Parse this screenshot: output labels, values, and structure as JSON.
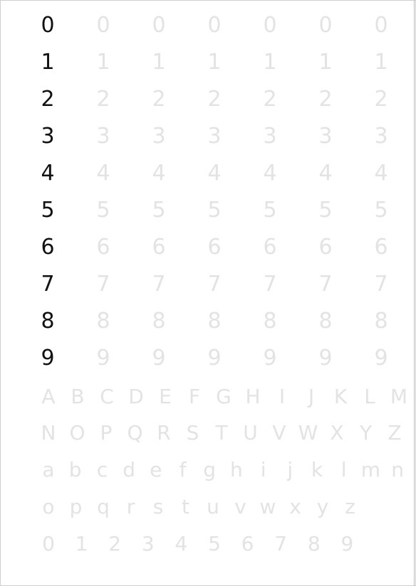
{
  "practice": {
    "digits": [
      {
        "model": "0",
        "traces": [
          "0",
          "0",
          "0",
          "0",
          "0",
          "0"
        ]
      },
      {
        "model": "1",
        "traces": [
          "1",
          "1",
          "1",
          "1",
          "1",
          "1"
        ]
      },
      {
        "model": "2",
        "traces": [
          "2",
          "2",
          "2",
          "2",
          "2",
          "2"
        ]
      },
      {
        "model": "3",
        "traces": [
          "3",
          "3",
          "3",
          "3",
          "3",
          "3"
        ]
      },
      {
        "model": "4",
        "traces": [
          "4",
          "4",
          "4",
          "4",
          "4",
          "4"
        ]
      },
      {
        "model": "5",
        "traces": [
          "5",
          "5",
          "5",
          "5",
          "5",
          "5"
        ]
      },
      {
        "model": "6",
        "traces": [
          "6",
          "6",
          "6",
          "6",
          "6",
          "6"
        ]
      },
      {
        "model": "7",
        "traces": [
          "7",
          "7",
          "7",
          "7",
          "7",
          "7"
        ]
      },
      {
        "model": "8",
        "traces": [
          "8",
          "8",
          "8",
          "8",
          "8",
          "8"
        ]
      },
      {
        "model": "9",
        "traces": [
          "9",
          "9",
          "9",
          "9",
          "9",
          "9"
        ]
      }
    ]
  },
  "alphabet": {
    "uppercase_1": [
      "A",
      "B",
      "C",
      "D",
      "E",
      "F",
      "G",
      "H",
      "I",
      "J",
      "K",
      "L",
      "M"
    ],
    "uppercase_2": [
      "N",
      "O",
      "P",
      "Q",
      "R",
      "S",
      "T",
      "U",
      "V",
      "W",
      "X",
      "Y",
      "Z"
    ],
    "lowercase_1": [
      "a",
      "b",
      "c",
      "d",
      "e",
      "f",
      "g",
      "h",
      "i",
      "j",
      "k",
      "l",
      "m",
      "n"
    ],
    "lowercase_2": [
      "o",
      "p",
      "q",
      "r",
      "s",
      "t",
      "u",
      "v",
      "w",
      "x",
      "y",
      "z"
    ],
    "numerals": [
      "0",
      "1",
      "2",
      "3",
      "4",
      "5",
      "6",
      "7",
      "8",
      "9"
    ]
  },
  "colors": {
    "model_ink": "#111111",
    "trace_ink": "#e3e3e3",
    "page": "#ffffff"
  }
}
